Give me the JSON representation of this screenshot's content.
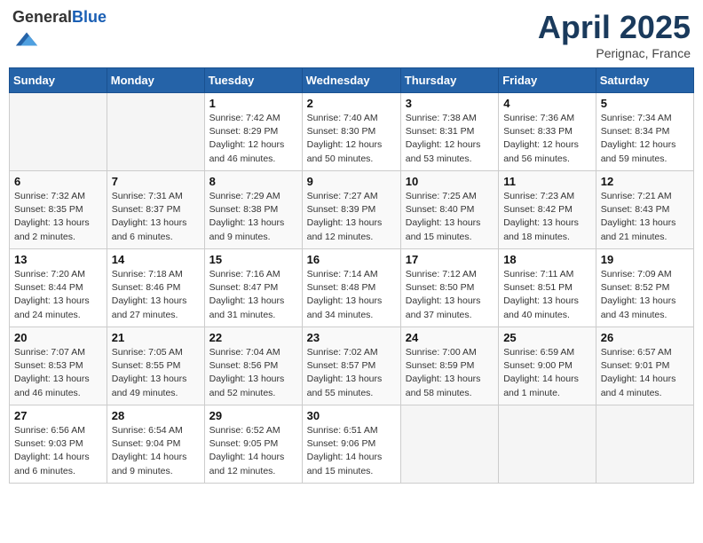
{
  "header": {
    "logo_general": "General",
    "logo_blue": "Blue",
    "month_year": "April 2025",
    "location": "Perignac, France"
  },
  "weekdays": [
    "Sunday",
    "Monday",
    "Tuesday",
    "Wednesday",
    "Thursday",
    "Friday",
    "Saturday"
  ],
  "weeks": [
    [
      {
        "day": "",
        "info": ""
      },
      {
        "day": "",
        "info": ""
      },
      {
        "day": "1",
        "info": "Sunrise: 7:42 AM\nSunset: 8:29 PM\nDaylight: 12 hours and 46 minutes."
      },
      {
        "day": "2",
        "info": "Sunrise: 7:40 AM\nSunset: 8:30 PM\nDaylight: 12 hours and 50 minutes."
      },
      {
        "day": "3",
        "info": "Sunrise: 7:38 AM\nSunset: 8:31 PM\nDaylight: 12 hours and 53 minutes."
      },
      {
        "day": "4",
        "info": "Sunrise: 7:36 AM\nSunset: 8:33 PM\nDaylight: 12 hours and 56 minutes."
      },
      {
        "day": "5",
        "info": "Sunrise: 7:34 AM\nSunset: 8:34 PM\nDaylight: 12 hours and 59 minutes."
      }
    ],
    [
      {
        "day": "6",
        "info": "Sunrise: 7:32 AM\nSunset: 8:35 PM\nDaylight: 13 hours and 2 minutes."
      },
      {
        "day": "7",
        "info": "Sunrise: 7:31 AM\nSunset: 8:37 PM\nDaylight: 13 hours and 6 minutes."
      },
      {
        "day": "8",
        "info": "Sunrise: 7:29 AM\nSunset: 8:38 PM\nDaylight: 13 hours and 9 minutes."
      },
      {
        "day": "9",
        "info": "Sunrise: 7:27 AM\nSunset: 8:39 PM\nDaylight: 13 hours and 12 minutes."
      },
      {
        "day": "10",
        "info": "Sunrise: 7:25 AM\nSunset: 8:40 PM\nDaylight: 13 hours and 15 minutes."
      },
      {
        "day": "11",
        "info": "Sunrise: 7:23 AM\nSunset: 8:42 PM\nDaylight: 13 hours and 18 minutes."
      },
      {
        "day": "12",
        "info": "Sunrise: 7:21 AM\nSunset: 8:43 PM\nDaylight: 13 hours and 21 minutes."
      }
    ],
    [
      {
        "day": "13",
        "info": "Sunrise: 7:20 AM\nSunset: 8:44 PM\nDaylight: 13 hours and 24 minutes."
      },
      {
        "day": "14",
        "info": "Sunrise: 7:18 AM\nSunset: 8:46 PM\nDaylight: 13 hours and 27 minutes."
      },
      {
        "day": "15",
        "info": "Sunrise: 7:16 AM\nSunset: 8:47 PM\nDaylight: 13 hours and 31 minutes."
      },
      {
        "day": "16",
        "info": "Sunrise: 7:14 AM\nSunset: 8:48 PM\nDaylight: 13 hours and 34 minutes."
      },
      {
        "day": "17",
        "info": "Sunrise: 7:12 AM\nSunset: 8:50 PM\nDaylight: 13 hours and 37 minutes."
      },
      {
        "day": "18",
        "info": "Sunrise: 7:11 AM\nSunset: 8:51 PM\nDaylight: 13 hours and 40 minutes."
      },
      {
        "day": "19",
        "info": "Sunrise: 7:09 AM\nSunset: 8:52 PM\nDaylight: 13 hours and 43 minutes."
      }
    ],
    [
      {
        "day": "20",
        "info": "Sunrise: 7:07 AM\nSunset: 8:53 PM\nDaylight: 13 hours and 46 minutes."
      },
      {
        "day": "21",
        "info": "Sunrise: 7:05 AM\nSunset: 8:55 PM\nDaylight: 13 hours and 49 minutes."
      },
      {
        "day": "22",
        "info": "Sunrise: 7:04 AM\nSunset: 8:56 PM\nDaylight: 13 hours and 52 minutes."
      },
      {
        "day": "23",
        "info": "Sunrise: 7:02 AM\nSunset: 8:57 PM\nDaylight: 13 hours and 55 minutes."
      },
      {
        "day": "24",
        "info": "Sunrise: 7:00 AM\nSunset: 8:59 PM\nDaylight: 13 hours and 58 minutes."
      },
      {
        "day": "25",
        "info": "Sunrise: 6:59 AM\nSunset: 9:00 PM\nDaylight: 14 hours and 1 minute."
      },
      {
        "day": "26",
        "info": "Sunrise: 6:57 AM\nSunset: 9:01 PM\nDaylight: 14 hours and 4 minutes."
      }
    ],
    [
      {
        "day": "27",
        "info": "Sunrise: 6:56 AM\nSunset: 9:03 PM\nDaylight: 14 hours and 6 minutes."
      },
      {
        "day": "28",
        "info": "Sunrise: 6:54 AM\nSunset: 9:04 PM\nDaylight: 14 hours and 9 minutes."
      },
      {
        "day": "29",
        "info": "Sunrise: 6:52 AM\nSunset: 9:05 PM\nDaylight: 14 hours and 12 minutes."
      },
      {
        "day": "30",
        "info": "Sunrise: 6:51 AM\nSunset: 9:06 PM\nDaylight: 14 hours and 15 minutes."
      },
      {
        "day": "",
        "info": ""
      },
      {
        "day": "",
        "info": ""
      },
      {
        "day": "",
        "info": ""
      }
    ]
  ]
}
